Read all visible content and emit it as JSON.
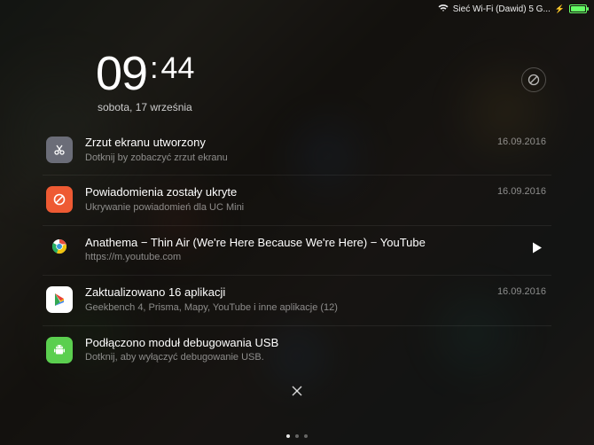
{
  "status": {
    "wifi_label": "Sieć Wi-Fi (Dawid) 5 G..."
  },
  "clock": {
    "hours": "09",
    "minutes": "44",
    "date": "sobota, 17 września"
  },
  "notifications": [
    {
      "icon": "scissors-icon",
      "title": "Zrzut ekranu utworzony",
      "subtitle": "Dotknij by zobaczyć zrzut ekranu",
      "date": "16.09.2016"
    },
    {
      "icon": "block-icon",
      "title": "Powiadomienia zostały ukryte",
      "subtitle": "Ukrywanie powiadomień dla UC Mini",
      "date": "16.09.2016"
    },
    {
      "icon": "chrome-icon",
      "title": "Anathema − Thin Air (We're Here Because We're Here) − YouTube",
      "subtitle": "https://m.youtube.com",
      "action": "play"
    },
    {
      "icon": "playstore-icon",
      "title": "Zaktualizowano 16 aplikacji",
      "subtitle": "Geekbench 4, Prisma, Mapy, YouTube i inne aplikacje (12)",
      "date": "16.09.2016"
    },
    {
      "icon": "android-icon",
      "title": "Podłączono moduł debugowania USB",
      "subtitle": "Dotknij, aby wyłączyć debugowanie USB."
    }
  ]
}
